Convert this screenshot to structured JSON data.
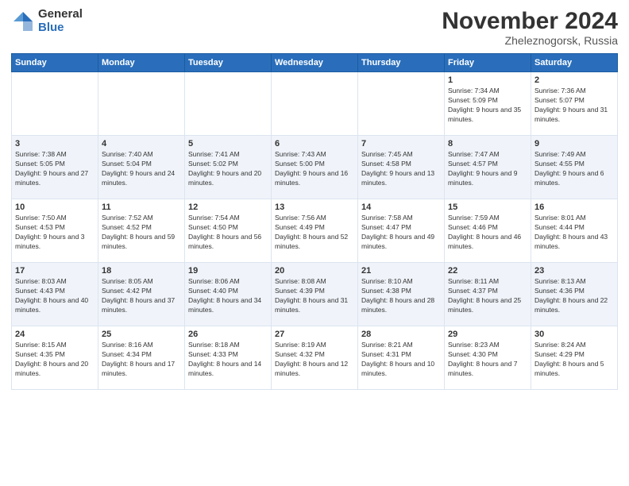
{
  "logo": {
    "general": "General",
    "blue": "Blue"
  },
  "header": {
    "month": "November 2024",
    "location": "Zheleznogorsk, Russia"
  },
  "days_of_week": [
    "Sunday",
    "Monday",
    "Tuesday",
    "Wednesday",
    "Thursday",
    "Friday",
    "Saturday"
  ],
  "weeks": [
    [
      {
        "day": "",
        "info": ""
      },
      {
        "day": "",
        "info": ""
      },
      {
        "day": "",
        "info": ""
      },
      {
        "day": "",
        "info": ""
      },
      {
        "day": "",
        "info": ""
      },
      {
        "day": "1",
        "info": "Sunrise: 7:34 AM\nSunset: 5:09 PM\nDaylight: 9 hours and 35 minutes."
      },
      {
        "day": "2",
        "info": "Sunrise: 7:36 AM\nSunset: 5:07 PM\nDaylight: 9 hours and 31 minutes."
      }
    ],
    [
      {
        "day": "3",
        "info": "Sunrise: 7:38 AM\nSunset: 5:05 PM\nDaylight: 9 hours and 27 minutes."
      },
      {
        "day": "4",
        "info": "Sunrise: 7:40 AM\nSunset: 5:04 PM\nDaylight: 9 hours and 24 minutes."
      },
      {
        "day": "5",
        "info": "Sunrise: 7:41 AM\nSunset: 5:02 PM\nDaylight: 9 hours and 20 minutes."
      },
      {
        "day": "6",
        "info": "Sunrise: 7:43 AM\nSunset: 5:00 PM\nDaylight: 9 hours and 16 minutes."
      },
      {
        "day": "7",
        "info": "Sunrise: 7:45 AM\nSunset: 4:58 PM\nDaylight: 9 hours and 13 minutes."
      },
      {
        "day": "8",
        "info": "Sunrise: 7:47 AM\nSunset: 4:57 PM\nDaylight: 9 hours and 9 minutes."
      },
      {
        "day": "9",
        "info": "Sunrise: 7:49 AM\nSunset: 4:55 PM\nDaylight: 9 hours and 6 minutes."
      }
    ],
    [
      {
        "day": "10",
        "info": "Sunrise: 7:50 AM\nSunset: 4:53 PM\nDaylight: 9 hours and 3 minutes."
      },
      {
        "day": "11",
        "info": "Sunrise: 7:52 AM\nSunset: 4:52 PM\nDaylight: 8 hours and 59 minutes."
      },
      {
        "day": "12",
        "info": "Sunrise: 7:54 AM\nSunset: 4:50 PM\nDaylight: 8 hours and 56 minutes."
      },
      {
        "day": "13",
        "info": "Sunrise: 7:56 AM\nSunset: 4:49 PM\nDaylight: 8 hours and 52 minutes."
      },
      {
        "day": "14",
        "info": "Sunrise: 7:58 AM\nSunset: 4:47 PM\nDaylight: 8 hours and 49 minutes."
      },
      {
        "day": "15",
        "info": "Sunrise: 7:59 AM\nSunset: 4:46 PM\nDaylight: 8 hours and 46 minutes."
      },
      {
        "day": "16",
        "info": "Sunrise: 8:01 AM\nSunset: 4:44 PM\nDaylight: 8 hours and 43 minutes."
      }
    ],
    [
      {
        "day": "17",
        "info": "Sunrise: 8:03 AM\nSunset: 4:43 PM\nDaylight: 8 hours and 40 minutes."
      },
      {
        "day": "18",
        "info": "Sunrise: 8:05 AM\nSunset: 4:42 PM\nDaylight: 8 hours and 37 minutes."
      },
      {
        "day": "19",
        "info": "Sunrise: 8:06 AM\nSunset: 4:40 PM\nDaylight: 8 hours and 34 minutes."
      },
      {
        "day": "20",
        "info": "Sunrise: 8:08 AM\nSunset: 4:39 PM\nDaylight: 8 hours and 31 minutes."
      },
      {
        "day": "21",
        "info": "Sunrise: 8:10 AM\nSunset: 4:38 PM\nDaylight: 8 hours and 28 minutes."
      },
      {
        "day": "22",
        "info": "Sunrise: 8:11 AM\nSunset: 4:37 PM\nDaylight: 8 hours and 25 minutes."
      },
      {
        "day": "23",
        "info": "Sunrise: 8:13 AM\nSunset: 4:36 PM\nDaylight: 8 hours and 22 minutes."
      }
    ],
    [
      {
        "day": "24",
        "info": "Sunrise: 8:15 AM\nSunset: 4:35 PM\nDaylight: 8 hours and 20 minutes."
      },
      {
        "day": "25",
        "info": "Sunrise: 8:16 AM\nSunset: 4:34 PM\nDaylight: 8 hours and 17 minutes."
      },
      {
        "day": "26",
        "info": "Sunrise: 8:18 AM\nSunset: 4:33 PM\nDaylight: 8 hours and 14 minutes."
      },
      {
        "day": "27",
        "info": "Sunrise: 8:19 AM\nSunset: 4:32 PM\nDaylight: 8 hours and 12 minutes."
      },
      {
        "day": "28",
        "info": "Sunrise: 8:21 AM\nSunset: 4:31 PM\nDaylight: 8 hours and 10 minutes."
      },
      {
        "day": "29",
        "info": "Sunrise: 8:23 AM\nSunset: 4:30 PM\nDaylight: 8 hours and 7 minutes."
      },
      {
        "day": "30",
        "info": "Sunrise: 8:24 AM\nSunset: 4:29 PM\nDaylight: 8 hours and 5 minutes."
      }
    ]
  ]
}
